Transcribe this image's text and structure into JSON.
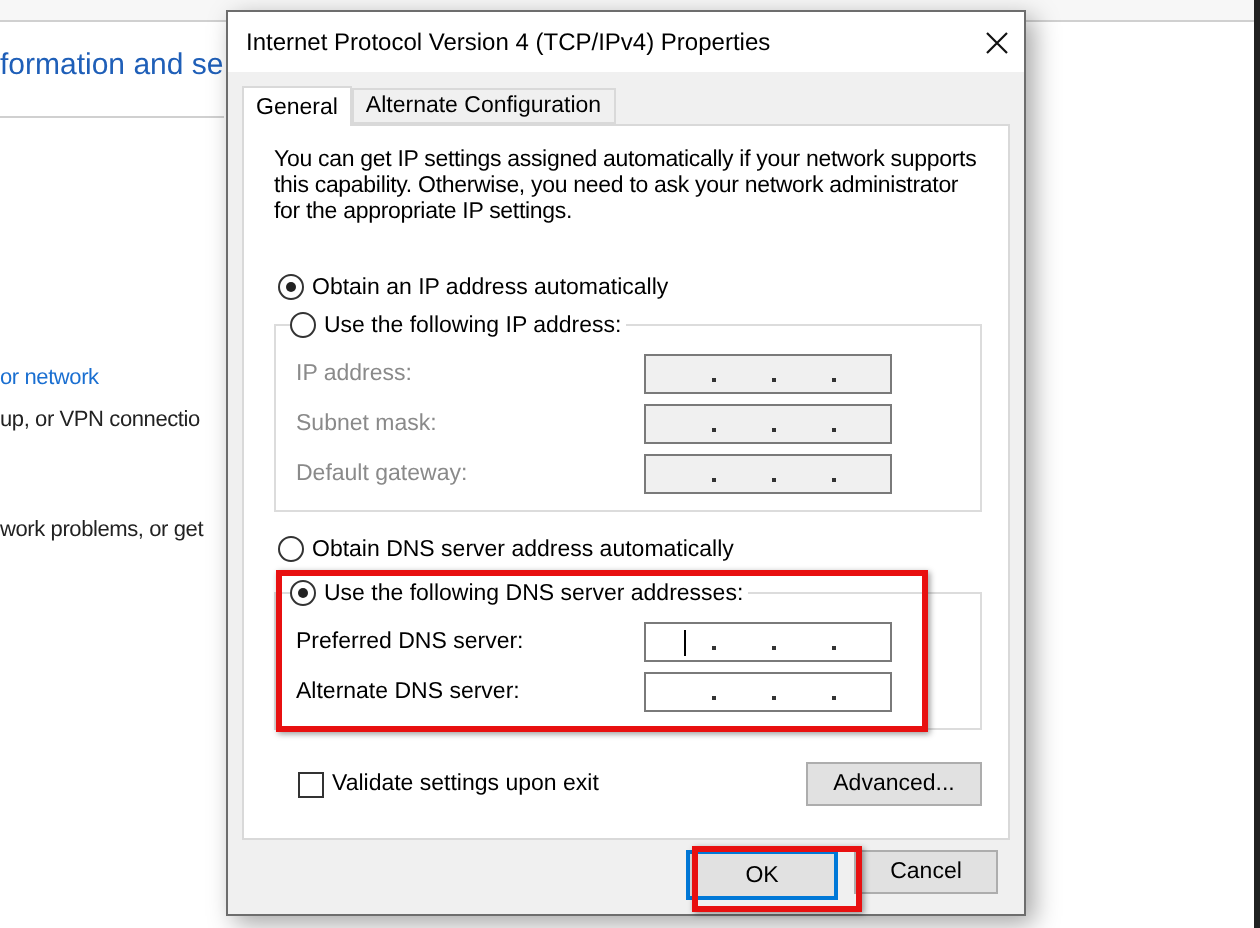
{
  "background_window": {
    "heading": "formation and se",
    "items": [
      {
        "kind": "link",
        "text": "or network"
      },
      {
        "kind": "text",
        "text": "up, or VPN connectio"
      },
      {
        "kind": "text",
        "text": "work problems, or get"
      }
    ]
  },
  "dialog": {
    "title": "Internet Protocol Version 4 (TCP/IPv4) Properties",
    "tabs": [
      {
        "label": "General",
        "selected": true
      },
      {
        "label": "Alternate Configuration",
        "selected": false
      }
    ],
    "description": [
      "You can get IP settings assigned automatically if your network supports",
      "this capability. Otherwise, you need to ask your network administrator",
      "for the appropriate IP settings."
    ],
    "ip_auto": {
      "label": "Obtain an IP address automatically",
      "selected": true
    },
    "ip_manual": {
      "label": "Use the following IP address:",
      "selected": false,
      "fields": [
        {
          "label": "IP address:",
          "disabled": true,
          "focused": false
        },
        {
          "label": "Subnet mask:",
          "disabled": true,
          "focused": false
        },
        {
          "label": "Default gateway:",
          "disabled": true,
          "focused": false
        }
      ]
    },
    "dns_auto": {
      "label": "Obtain DNS server address automatically",
      "selected": false
    },
    "dns_manual": {
      "label": "Use the following DNS server addresses:",
      "selected": true,
      "highlighted": true,
      "fields": [
        {
          "label": "Preferred DNS server:",
          "disabled": false,
          "focused": true
        },
        {
          "label": "Alternate DNS server:",
          "disabled": false,
          "focused": false
        }
      ]
    },
    "validate": {
      "label": "Validate settings upon exit",
      "checked": false
    },
    "advanced_button": "Advanced...",
    "ok_button": {
      "label": "OK",
      "highlighted": true
    },
    "cancel_button": "Cancel"
  }
}
